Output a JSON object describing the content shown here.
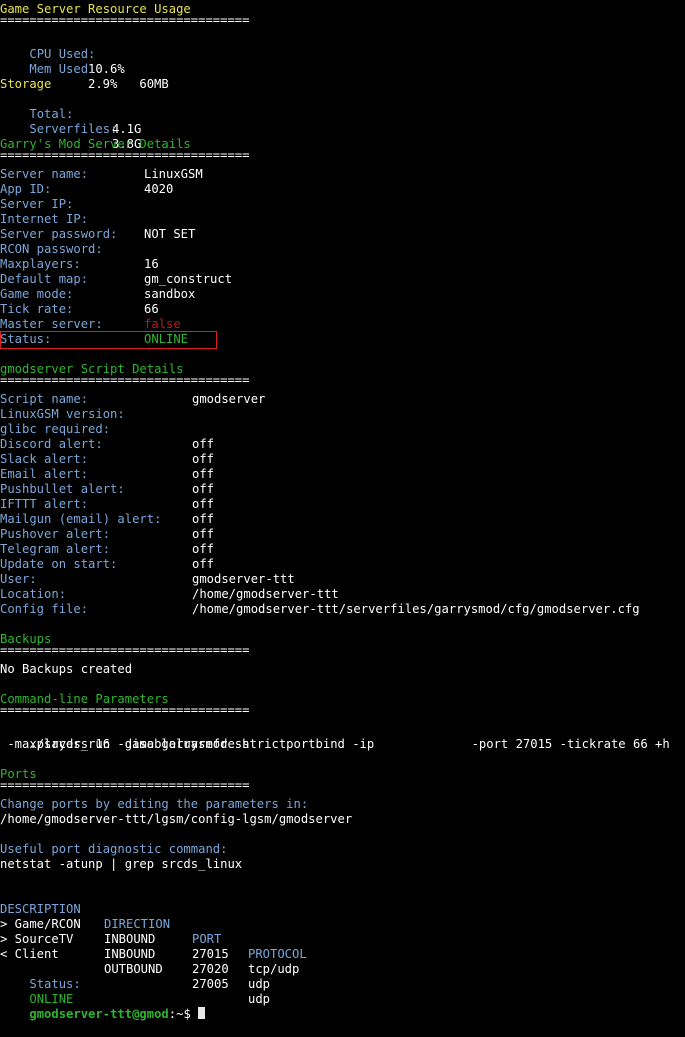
{
  "resource": {
    "title": "Game Server Resource Usage",
    "rule": "==================================",
    "cpu_label": "CPU Used:",
    "cpu_value": "10.6%",
    "mem_label": "Mem Used:",
    "mem_value": "2.9%   60MB"
  },
  "storage": {
    "title": "Storage",
    "total_label": "Total:",
    "total_value": "4.1G",
    "sf_label": "Serverfiles:",
    "sf_value": "3.8G"
  },
  "details": {
    "title": "Garry's Mod Server Details",
    "rule": "==================================",
    "rows": [
      {
        "label": "Server name:",
        "value": "LinuxGSM"
      },
      {
        "label": "App ID:",
        "value": "4020"
      },
      {
        "label": "Server IP:",
        "value": ""
      },
      {
        "label": "Internet IP:",
        "value": ""
      },
      {
        "label": "Server password:",
        "value": "NOT SET"
      },
      {
        "label": "RCON password:",
        "value": ""
      },
      {
        "label": "Maxplayers:",
        "value": "16"
      },
      {
        "label": "Default map:",
        "value": "gm_construct"
      },
      {
        "label": "Game mode:",
        "value": "sandbox"
      },
      {
        "label": "Tick rate:",
        "value": "66"
      },
      {
        "label": "Master server:",
        "value": "false"
      },
      {
        "label": "Status:",
        "value": "ONLINE"
      }
    ]
  },
  "script": {
    "title": "gmodserver Script Details",
    "rule": "==================================",
    "rows": [
      {
        "label": "Script name:",
        "value": "gmodserver"
      },
      {
        "label": "LinuxGSM version:",
        "value": ""
      },
      {
        "label": "glibc required:",
        "value": ""
      },
      {
        "label": "Discord alert:",
        "value": "off"
      },
      {
        "label": "Slack alert:",
        "value": "off"
      },
      {
        "label": "Email alert:",
        "value": "off"
      },
      {
        "label": "Pushbullet alert:",
        "value": "off"
      },
      {
        "label": "IFTTT alert:",
        "value": "off"
      },
      {
        "label": "Mailgun (email) alert:",
        "value": "off"
      },
      {
        "label": "Pushover alert:",
        "value": "off"
      },
      {
        "label": "Telegram alert:",
        "value": "off"
      },
      {
        "label": "Update on start:",
        "value": "off"
      },
      {
        "label": "User:",
        "value": "gmodserver-ttt"
      },
      {
        "label": "Location:",
        "value": "/home/gmodserver-ttt"
      },
      {
        "label": "Config file:",
        "value": "/home/gmodserver-ttt/serverfiles/garrysmod/cfg/gmodserver.cfg"
      }
    ]
  },
  "backups": {
    "title": "Backups",
    "rule": "==================================",
    "text": "No Backups created"
  },
  "cmdline": {
    "title": "Command-line Parameters",
    "rule": "==================================",
    "line1_a": "./srcds_run -game garrysmod -strictportbind -ip ",
    "line1_b": "-port 27015 -tickrate 66 +h",
    "line2": " -maxplayers 16 -disableluarefresh"
  },
  "ports": {
    "title": "Ports",
    "rule": "==================================",
    "change_label": "Change ports by editing the parameters in:",
    "change_path": "/home/gmodserver-ttt/lgsm/config-lgsm/gmodserver",
    "diag_label": "Useful port diagnostic command:",
    "diag_cmd": "netstat -atunp | grep srcds_linux",
    "headers": [
      "DESCRIPTION",
      "DIRECTION",
      "PORT",
      "PROTOCOL"
    ],
    "rows": [
      [
        "> Game/RCON",
        "INBOUND",
        "27015",
        "tcp/udp"
      ],
      [
        "> SourceTV",
        "INBOUND",
        "27020",
        "udp"
      ],
      [
        "< Client",
        "OUTBOUND",
        "27005",
        "udp"
      ]
    ],
    "status_label": "Status:",
    "status_value": "ONLINE"
  },
  "prompt": {
    "user_host": "gmodserver-ttt@gmod",
    "path": ":~$ "
  },
  "colors": {
    "background": "#000000",
    "heading_yellow": "#e5e34d",
    "heading_green": "#2fb52f",
    "label_blue": "#7aa6da",
    "status_red": "#c01717",
    "highlight_box": "#e02020"
  }
}
